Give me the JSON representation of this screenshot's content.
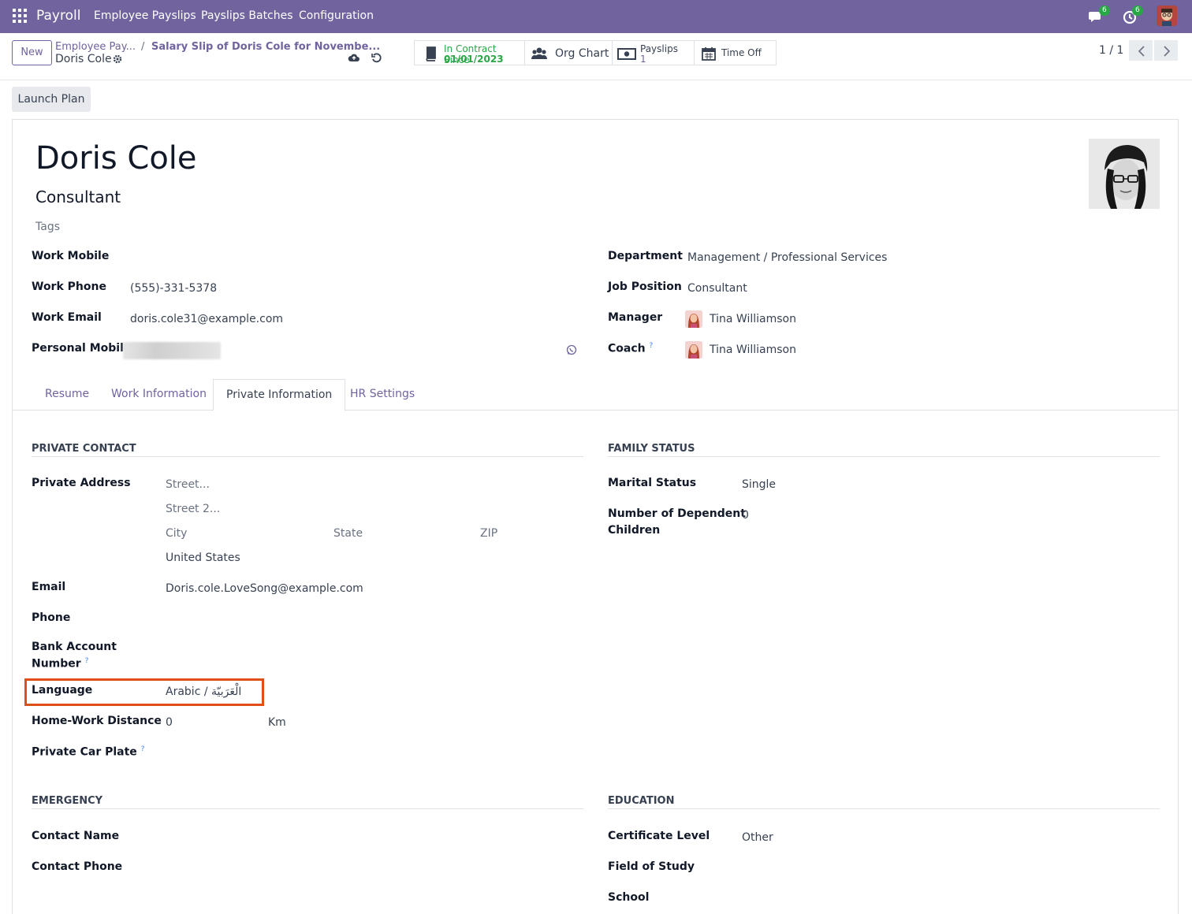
{
  "navbar": {
    "app": "Payroll",
    "menu": [
      "Employee Payslips",
      "Payslips Batches",
      "Configuration"
    ],
    "messages_badge": "6",
    "activities_badge": "6",
    "brand_color": "#71639e"
  },
  "control": {
    "new_label": "New",
    "breadcrumb_1": "Employee Pay...",
    "breadcrumb_sep": "/",
    "breadcrumb_2": "Salary Slip of Doris Cole for Novembe...",
    "current": "Doris Cole",
    "smart_buttons": {
      "contract": {
        "line1": "In Contract Since",
        "line2": "01/01/2023"
      },
      "org_chart": {
        "label": "Org Chart"
      },
      "payslips": {
        "line1": "Payslips",
        "line2": "1"
      },
      "time_off": {
        "label": "Time Off"
      }
    },
    "pager": "1 / 1"
  },
  "actions": {
    "launch_plan": "Launch Plan"
  },
  "employee": {
    "name": "Doris Cole",
    "job_title": "Consultant",
    "tags_placeholder": "Tags",
    "fields_left": {
      "work_mobile_label": "Work Mobile",
      "work_phone_label": "Work Phone",
      "work_phone": "(555)-331-5378",
      "work_email_label": "Work Email",
      "work_email": "doris.cole31@example.com",
      "personal_mobile_label": "Personal Mobile"
    },
    "fields_right": {
      "department_label": "Department",
      "department": "Management / Professional Services",
      "job_position_label": "Job Position",
      "job_position": "Consultant",
      "manager_label": "Manager",
      "manager": "Tina Williamson",
      "coach_label": "Coach",
      "coach": "Tina Williamson"
    }
  },
  "tabs": [
    "Resume",
    "Work Information",
    "Private Information",
    "HR Settings"
  ],
  "private": {
    "section_contact": "PRIVATE CONTACT",
    "private_address_label": "Private Address",
    "street_ph": "Street...",
    "street2_ph": "Street 2...",
    "city_ph": "City",
    "state_ph": "State",
    "zip_ph": "ZIP",
    "country": "United States",
    "email_label": "Email",
    "email": "Doris.cole.LoveSong@example.com",
    "phone_label": "Phone",
    "bank_label_1": "Bank Account",
    "bank_label_2": "Number",
    "language_label": "Language",
    "language": "Arabic / الْعَرَبيّة",
    "distance_label": "Home-Work Distance",
    "distance": "0",
    "distance_unit": "Km",
    "car_plate_label": "Private Car Plate",
    "section_family": "FAMILY STATUS",
    "marital_label": "Marital Status",
    "marital": "Single",
    "children_label_1": "Number of Dependent",
    "children_label_2": "Children",
    "children": "0",
    "section_emergency": "EMERGENCY",
    "contact_name_label": "Contact Name",
    "contact_phone_label": "Contact Phone",
    "section_education": "EDUCATION",
    "certificate_label": "Certificate Level",
    "certificate": "Other",
    "field_of_study_label": "Field of Study",
    "school_label": "School"
  },
  "help_mark": "?"
}
